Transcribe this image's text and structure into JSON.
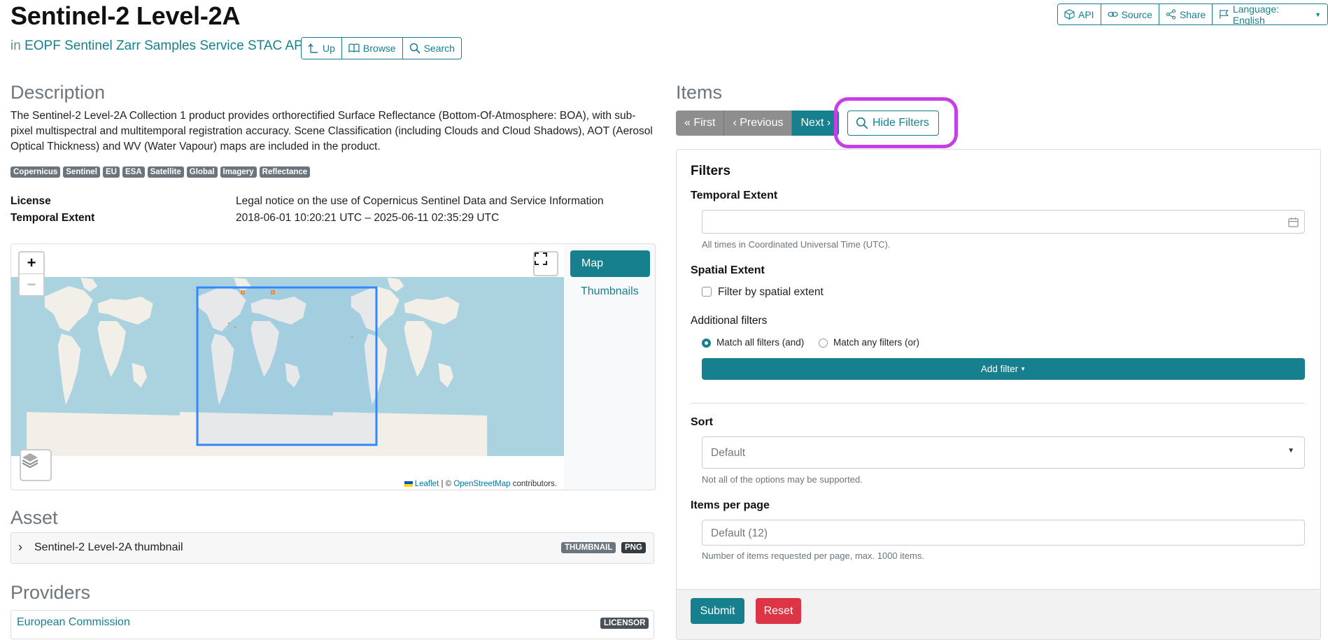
{
  "header": {
    "title": "Sentinel-2 Level-2A",
    "in_prefix": "in",
    "parent_link": "EOPF Sentinel Zarr Samples Service STAC API",
    "nav": {
      "up": "Up",
      "browse": "Browse",
      "search": "Search"
    },
    "top": {
      "api": "API",
      "source": "Source",
      "share": "Share",
      "language": "Language: English"
    }
  },
  "description": {
    "heading": "Description",
    "text": "The Sentinel-2 Level-2A Collection 1 product provides orthorectified Surface Reflectance (Bottom-Of-Atmosphere: BOA), with sub-pixel multispectral and multitemporal registration accuracy. Scene Classification (including Clouds and Cloud Shadows), AOT (Aerosol Optical Thickness) and WV (Water Vapour) maps are included in the product.",
    "keywords": [
      "Copernicus",
      "Sentinel",
      "EU",
      "ESA",
      "Satellite",
      "Global",
      "Imagery",
      "Reflectance"
    ],
    "license_label": "License",
    "license_value": "Legal notice on the use of Copernicus Sentinel Data and Service Information",
    "temporal_label": "Temporal Extent",
    "temporal_value": "2018-06-01 10:20:21 UTC – 2025-06-11 02:35:29 UTC"
  },
  "map": {
    "zoom_in": "+",
    "zoom_out": "−",
    "attribution_leaflet": "Leaflet",
    "attribution_sep": "| ©",
    "attribution_osm": "OpenStreetMap",
    "attribution_suffix": "contributors.",
    "view_map": "Map",
    "view_thumbnails": "Thumbnails"
  },
  "asset": {
    "heading": "Asset",
    "name": "Sentinel-2 Level-2A thumbnail",
    "badge1": "THUMBNAIL",
    "badge2": "PNG"
  },
  "providers": {
    "heading": "Providers",
    "name": "European Commission",
    "badge": "LICENSOR"
  },
  "items": {
    "heading": "Items",
    "first": "« First",
    "previous": "‹ Previous",
    "next": "Next ›",
    "hide_filters": "Hide Filters"
  },
  "filters": {
    "title": "Filters",
    "temporal_label": "Temporal Extent",
    "temporal_value": "",
    "temporal_hint": "All times in Coordinated Universal Time (UTC).",
    "spatial_label": "Spatial Extent",
    "spatial_checkbox": "Filter by spatial extent",
    "additional_label": "Additional filters",
    "match_all": "Match all filters (and)",
    "match_any": "Match any filters (or)",
    "add_filter": "Add filter",
    "sort_label": "Sort",
    "sort_value": "Default",
    "sort_hint": "Not all of the options may be supported.",
    "per_page_label": "Items per page",
    "per_page_placeholder": "Default (12)",
    "per_page_hint": "Number of items requested per page, max. 1000 items.",
    "submit": "Submit",
    "reset": "Reset"
  },
  "colors": {
    "accent": "#17808e",
    "ocean": "#aad3df",
    "land": "#f2efe9",
    "bbox": "#3388ff",
    "highlight": "#c53ee6",
    "reset": "#dc3545"
  }
}
